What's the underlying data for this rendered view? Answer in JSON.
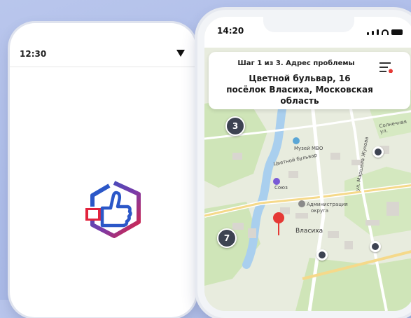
{
  "left_phone": {
    "status_time": "12:30",
    "logo_icon": "thumbs-up-logo-icon"
  },
  "right_phone": {
    "status_time": "14:20",
    "header": {
      "step": "Шаг 1 из 3.  Адрес проблемы",
      "address_line1": "Цветной бульвар, 16",
      "address_line2": "посёлок Власиха, Московская",
      "address_line3": "область",
      "menu_icon": "list-filter-icon"
    },
    "map": {
      "clusters": [
        "3",
        "7"
      ],
      "city": "Власиха",
      "labels": {
        "museum": "Музей МВО",
        "admin": "Администрация",
        "admin2": "округа",
        "street1": "Цветной бульвар",
        "street2": "ул. Маршала Жукова",
        "street3": "Солнечная ул.",
        "store": "Союз"
      }
    }
  },
  "colors": {
    "accent_blue": "#2b57c8",
    "accent_red": "#e2233d",
    "pin_red": "#e53935",
    "cluster": "#3d4352"
  }
}
